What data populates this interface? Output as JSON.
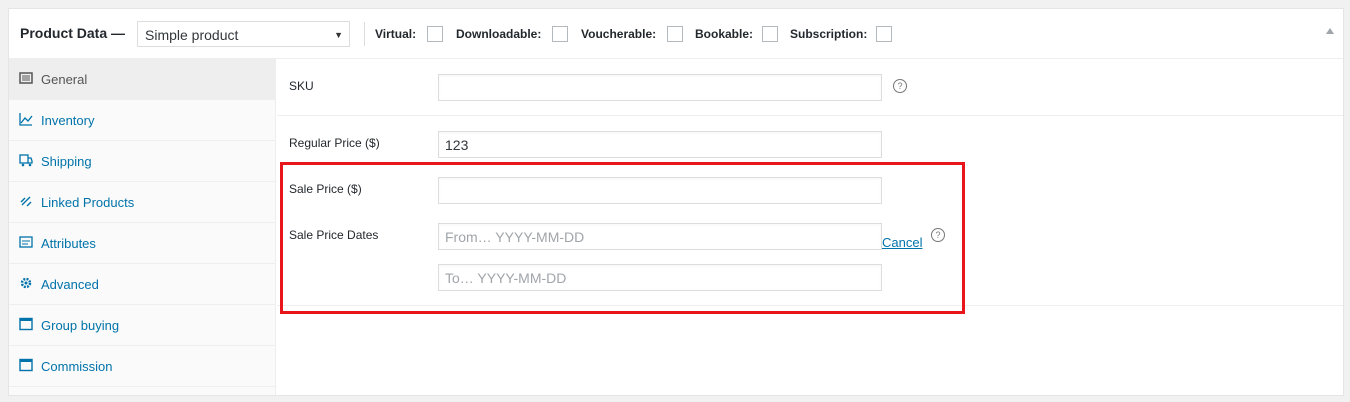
{
  "header": {
    "title": "Product Data —",
    "product_type": "Simple product",
    "options": [
      {
        "label": "Virtual:"
      },
      {
        "label": "Downloadable:"
      },
      {
        "label": "Voucherable:"
      },
      {
        "label": "Bookable:"
      },
      {
        "label": "Subscription:"
      }
    ]
  },
  "tabs": [
    {
      "label": "General",
      "icon": "table-icon",
      "active": true
    },
    {
      "label": "Inventory",
      "icon": "chart-line-icon"
    },
    {
      "label": "Shipping",
      "icon": "truck-icon"
    },
    {
      "label": "Linked Products",
      "icon": "link-icon"
    },
    {
      "label": "Attributes",
      "icon": "list-icon"
    },
    {
      "label": "Advanced",
      "icon": "gear-icon"
    },
    {
      "label": "Group buying",
      "icon": "window-icon"
    },
    {
      "label": "Commission",
      "icon": "window-icon"
    }
  ],
  "fields": {
    "sku": {
      "label": "SKU",
      "value": ""
    },
    "regular_price": {
      "label": "Regular Price ($)",
      "value": "123"
    },
    "sale_price": {
      "label": "Sale Price ($)",
      "value": ""
    },
    "sale_dates": {
      "label": "Sale Price Dates",
      "from_placeholder": "From… YYYY-MM-DD",
      "to_placeholder": "To…  YYYY-MM-DD",
      "cancel": "Cancel"
    }
  },
  "help_glyph": "?",
  "colors": {
    "link": "#0073aa",
    "highlight": "#e8151b"
  }
}
